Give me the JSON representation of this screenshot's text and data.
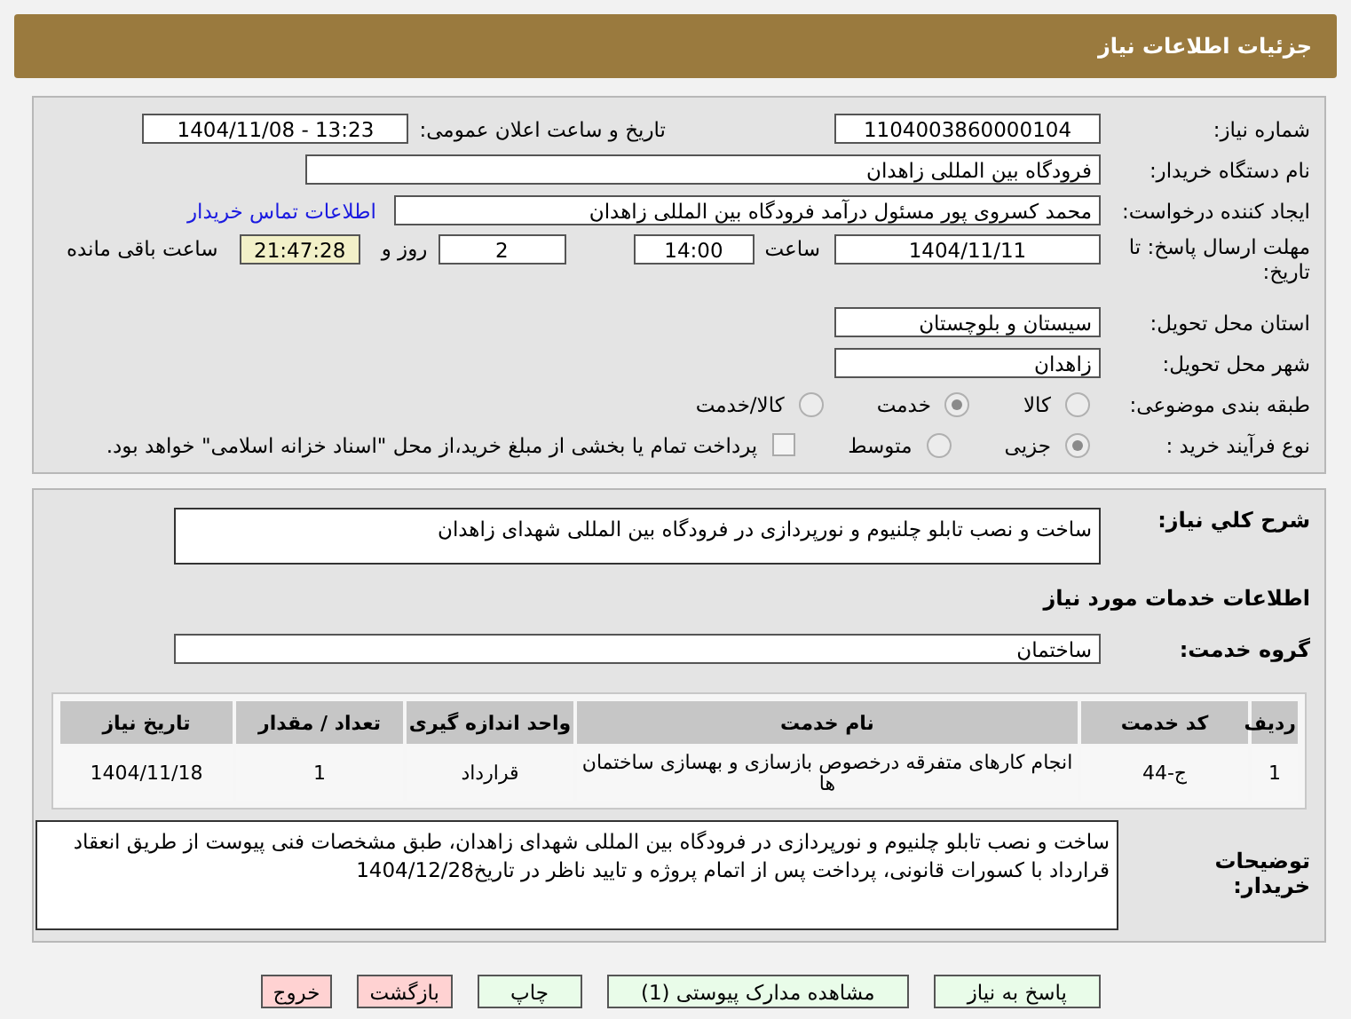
{
  "window": {
    "title": "جزئیات اطلاعات نیاز"
  },
  "need_number": {
    "label": "شماره نیاز:",
    "value": "1104003860000104"
  },
  "announce": {
    "label": "تاریخ و ساعت اعلان عمومی:",
    "value": "1404/11/08 - 13:23"
  },
  "buyer_org": {
    "label": "نام دستگاه خریدار:",
    "value": "فرودگاه بین المللی زاهدان"
  },
  "requester": {
    "label": "ایجاد کننده درخواست:",
    "value": "محمد کسروی پور مسئول درآمد فرودگاه بین المللی زاهدان",
    "link": "اطلاعات تماس خریدار"
  },
  "deadline": {
    "label": "مهلت ارسال پاسخ: تا تاریخ:",
    "date": "1404/11/11",
    "time_label": "ساعت",
    "time": "14:00",
    "days": "2",
    "days_label": "روز و",
    "remaining": "21:47:28",
    "remaining_label": "ساعت باقی مانده"
  },
  "province": {
    "label": "استان محل تحویل:",
    "value": "سیستان و بلوچستان"
  },
  "city": {
    "label": "شهر محل تحویل:",
    "value": "زاهدان"
  },
  "category": {
    "label": "طبقه بندی موضوعی:",
    "options": [
      {
        "label": "کالا",
        "selected": false
      },
      {
        "label": "خدمت",
        "selected": true
      },
      {
        "label": "کالا/خدمت",
        "selected": false
      }
    ]
  },
  "purchase_type": {
    "label": "نوع فرآیند خرید :",
    "options": [
      {
        "label": "جزیی",
        "selected": true
      },
      {
        "label": "متوسط",
        "selected": false
      }
    ],
    "checkbox": {
      "label": "پرداخت تمام یا بخشی از مبلغ خرید،از محل \"اسناد خزانه اسلامی\" خواهد بود.",
      "checked": false
    }
  },
  "description": {
    "label": "شرح کلي نياز:",
    "value": "ساخت و نصب تابلو چلنیوم و نورپردازی در فرودگاه بین المللی شهدای زاهدان"
  },
  "services_title": "اطلاعات خدمات مورد نياز",
  "service_group": {
    "label": "گروه خدمت:",
    "value": "ساختمان"
  },
  "table": {
    "columns": [
      "ردیف",
      "کد خدمت",
      "نام خدمت",
      "واحد اندازه گیری",
      "تعداد / مقدار",
      "تاریخ نیاز"
    ],
    "rows": [
      [
        "1",
        "ج-44",
        "انجام کارهای متفرقه درخصوص بازسازی و بهسازی ساختمان ها",
        "قرارداد",
        "1",
        "1404/11/18"
      ]
    ]
  },
  "buyer_notes": {
    "label": "توضیحات خریدار:",
    "value": "ساخت و نصب تابلو چلنیوم و نورپردازی در فرودگاه بین المللی شهدای زاهدان، طبق مشخصات فنی پیوست از طریق انعقاد قرارداد با کسورات قانونی، پرداخت پس از اتمام پروژه و تایید ناظر در تاریخ1404/12/28"
  },
  "buttons": [
    {
      "label": "پاسخ به نیاز",
      "kind": "normal"
    },
    {
      "label": "مشاهده مدارک پیوستی (1)",
      "kind": "normal"
    },
    {
      "label": "چاپ",
      "kind": "normal"
    },
    {
      "label": "بازگشت",
      "kind": "exit"
    },
    {
      "label": "خروج",
      "kind": "exit"
    }
  ]
}
